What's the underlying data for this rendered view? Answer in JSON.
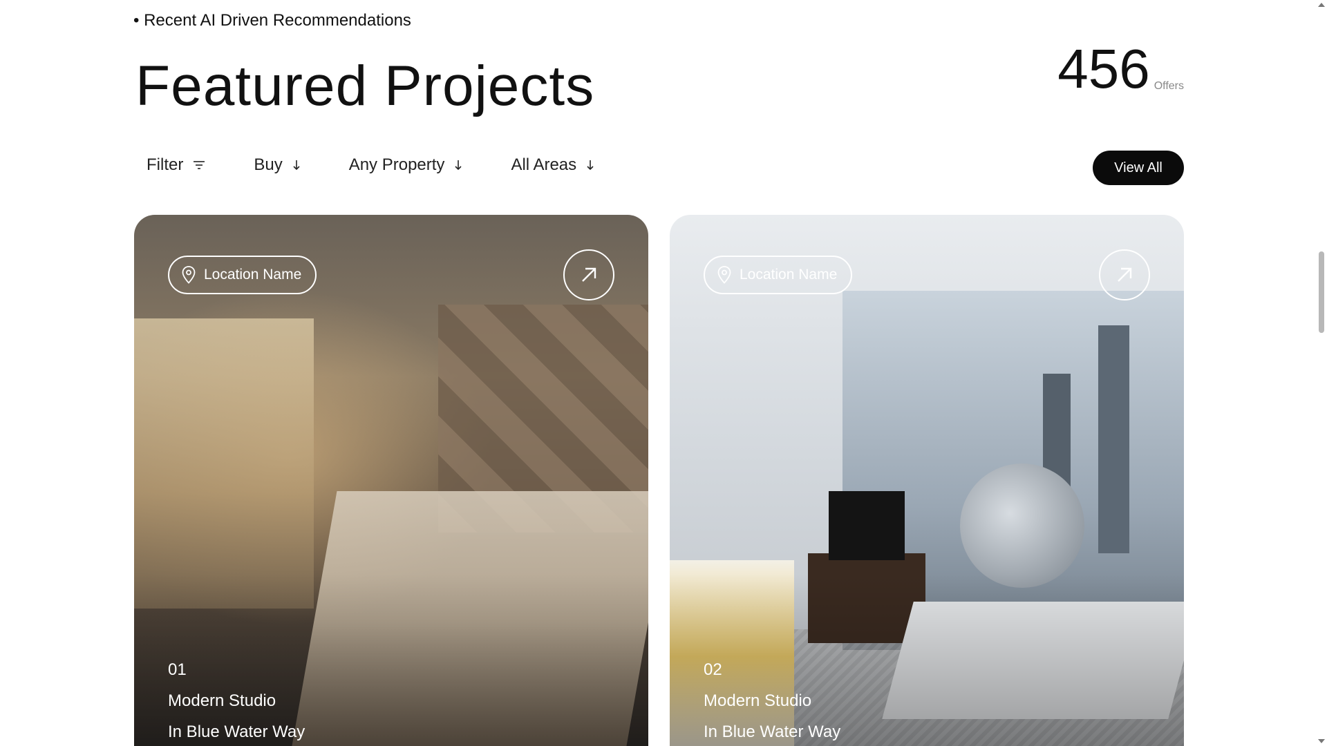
{
  "section": {
    "eyebrow": "• Recent AI Driven Recommendations",
    "title": "Featured Projects",
    "offers_count": "456",
    "offers_label": "Offers"
  },
  "filters": {
    "filter_label": "Filter",
    "buy_label": "Buy",
    "property_label": "Any Property",
    "areas_label": "All Areas",
    "view_all_label": "View All"
  },
  "cards": [
    {
      "location": "Location Name",
      "number": "01",
      "name": "Modern Studio",
      "subtitle": "In Blue Water Way"
    },
    {
      "location": "Location Name",
      "number": "02",
      "name": "Modern Studio",
      "subtitle": "In Blue Water Way"
    }
  ],
  "icons": {
    "filter": "filter-lines-icon",
    "dropdown": "arrow-down-icon",
    "location": "map-pin-icon",
    "open": "arrow-up-right-icon"
  },
  "colors": {
    "button_bg": "#0b0b0b",
    "text": "#111111",
    "muted": "#888888"
  }
}
